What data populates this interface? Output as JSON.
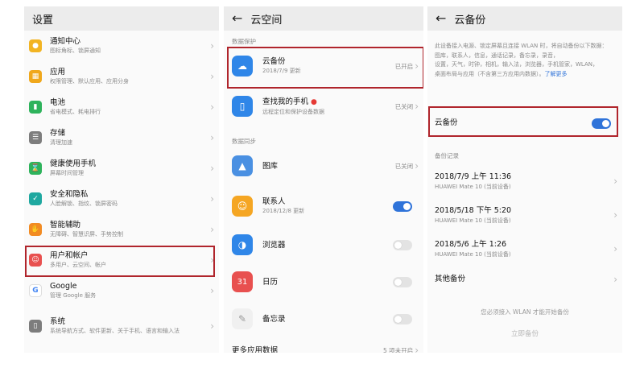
{
  "panel1": {
    "title": "设置",
    "items": [
      {
        "title": "通知中心",
        "sub": "图标角标、锁屏通知",
        "icon": "bell-icon",
        "color": "#f2b423"
      },
      {
        "title": "应用",
        "sub": "权限管理、默认应用、应用分身",
        "icon": "apps-grid-icon",
        "color": "#f0a81c"
      },
      {
        "title": "电池",
        "sub": "省电模式、耗电排行",
        "icon": "battery-icon",
        "color": "#2eb35c"
      },
      {
        "title": "存储",
        "sub": "清理加速",
        "icon": "storage-icon",
        "color": "#7d7d7d"
      },
      {
        "title": "健康使用手机",
        "sub": "屏幕时间管理",
        "icon": "hourglass-icon",
        "color": "#2eb35c"
      },
      {
        "title": "安全和隐私",
        "sub": "人脸解锁、指纹、锁屏密码",
        "icon": "shield-icon",
        "color": "#1fa8a0"
      },
      {
        "title": "智能辅助",
        "sub": "无障碍、智慧识屏、手势控制",
        "icon": "hand-icon",
        "color": "#f28b23"
      },
      {
        "title": "用户和帐户",
        "sub": "多用户、云空间、帐户",
        "icon": "user-icon",
        "color": "#e8504f"
      },
      {
        "title": "Google",
        "sub": "管理 Google 服务",
        "icon": "google-icon",
        "color": "#ffffff"
      },
      {
        "title": "系统",
        "sub": "系统导航方式、软件更新、关于手机、语言和输入法",
        "icon": "phone-system-icon",
        "color": "#7d7d7d"
      }
    ]
  },
  "panel2": {
    "title": "云空间",
    "section_protect": "数据保护",
    "cloud_backup": {
      "title": "云备份",
      "sub": "2018/7/9 更新",
      "status": "已开启",
      "color": "#2f86e8"
    },
    "find_phone": {
      "title": "查找我的手机",
      "sub": "远程定位和保护设备数据",
      "status": "已关闭",
      "color": "#2f86e8"
    },
    "section_sync": "数据同步",
    "gallery": {
      "title": "图库",
      "status": "已关闭",
      "color": "#4a90e2"
    },
    "contacts": {
      "title": "联系人",
      "sub": "2018/12/8 更新",
      "toggle": "on",
      "color": "#f5a623"
    },
    "browser": {
      "title": "浏览器",
      "toggle": "off",
      "color": "#2f86e8"
    },
    "calendar": {
      "title": "日历",
      "icon_text": "31",
      "toggle": "off",
      "color": "#e8504f"
    },
    "notes": {
      "title": "备忘录",
      "toggle": "off",
      "color": "#f0f0f0"
    },
    "more": {
      "title": "更多应用数据",
      "status": "5 项未开启"
    }
  },
  "panel3": {
    "title": "云备份",
    "description": "此设备接入电源、锁定屏幕且连接 WLAN 时，将自动备份以下数据：\n图库，联系人，信息，通话记录，备忘录，录音，\n设置，天气，时钟，相机，输入法，浏览器，手机管家，WLAN，\n桌面布局与应用（不含第三方应用内数据）。",
    "learn_more": "了解更多",
    "toggle_label": "云备份",
    "toggle_state": "on",
    "records_header": "备份记录",
    "records": [
      {
        "time": "2018/7/9 上午 11:36",
        "device": "HUAWEI Mate 10 (当前设备)"
      },
      {
        "time": "2018/5/18 下午 5:20",
        "device": "HUAWEI Mate 10 (当前设备)"
      },
      {
        "time": "2018/5/6 上午 1:26",
        "device": "HUAWEI Mate 10 (当前设备)"
      }
    ],
    "other_backups": "其他备份",
    "wlan_hint": "您必须接入 WLAN 才能开始备份",
    "backup_now": "立即备份"
  },
  "colors": {
    "accent": "#2f73d9",
    "highlight": "#b0252c"
  }
}
